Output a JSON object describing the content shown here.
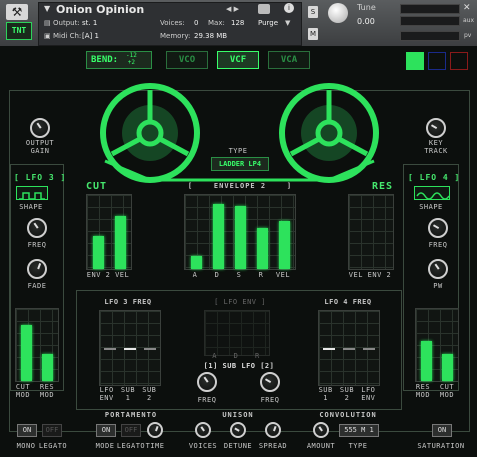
{
  "header": {
    "instrument_name": "Onion Opinion",
    "output_label": "Output:",
    "output_value": "st. 1",
    "midi_label": "Midi Ch:",
    "midi_value": "[A] 1",
    "voices_label": "Voices:",
    "voices_value": "0",
    "max_label": "Max:",
    "max_value": "128",
    "memory_label": "Memory:",
    "memory_value": "29.38 MB",
    "purge_label": "Purge",
    "s_label": "S",
    "m_label": "M",
    "tune_label": "Tune",
    "tune_value": "0.00",
    "aux_label": "aux",
    "pv_label": "pv"
  },
  "logo": "TNT",
  "top_bar": {
    "bend_label": "BEND:",
    "bend_top": "-12",
    "bend_bottom": "+2",
    "tabs": [
      "VCO",
      "VCF",
      "VCA"
    ],
    "active_tab": "VCF"
  },
  "color_squares": [
    "#2de25c",
    "#1a2a8a",
    "#8a1a1a"
  ],
  "top_section": {
    "output_gain_label": "OUTPUT\nGAIN",
    "key_track_label": "KEY\nTRACK",
    "type_label": "TYPE",
    "type_value": "LADDER LP4"
  },
  "lfo3": {
    "title": "[ LFO 3 ]",
    "shape_label": "SHAPE",
    "freq_label": "FREQ",
    "fade_label": "FADE",
    "cut_mod_label": "CUT\nMOD",
    "res_mod_label": "RES\nMOD",
    "mod_values": [
      0.78,
      0.38
    ]
  },
  "lfo4": {
    "title": "[ LFO 4 ]",
    "shape_label": "SHAPE",
    "freq_label": "FREQ",
    "pw_label": "PW",
    "res_mod_label": "RES\nMOD",
    "cut_mod_label": "CUT\nMOD",
    "mod_values": [
      0.55,
      0.38
    ]
  },
  "cut": {
    "title": "CUT",
    "labels": [
      "ENV 2",
      "VEL"
    ],
    "values": [
      0.45,
      0.72
    ]
  },
  "res": {
    "title": "RES",
    "labels": [
      "VEL",
      "ENV 2"
    ],
    "values": [
      0,
      0
    ]
  },
  "envelope2": {
    "title": "ENVELOPE 2",
    "labels": [
      "A",
      "D",
      "S",
      "R",
      "VEL"
    ],
    "values": [
      0.18,
      0.88,
      0.85,
      0.55,
      0.65
    ]
  },
  "lfo3_freq": {
    "title": "LFO 3 FREQ",
    "labels": [
      "LFO\nENV",
      "SUB\n1",
      "SUB\n2"
    ],
    "values": [
      0,
      0.45,
      0
    ]
  },
  "lfo_env": {
    "title": "[ LFO ENV ]",
    "labels": [
      "A",
      "D",
      "R"
    ]
  },
  "sub_lfo": {
    "title": "[1] SUB LFO [2]",
    "freq_label": "FREQ"
  },
  "lfo4_freq": {
    "title": "LFO 4 FREQ",
    "labels": [
      "SUB\n1",
      "SUB\n2",
      "LFO\nENV"
    ],
    "values": [
      0.45,
      0,
      0
    ]
  },
  "bottom": {
    "portamento_label": "PORTAMENTO",
    "unison_label": "UNISON",
    "convolution_label": "CONVOLUTION",
    "mono_on": "ON",
    "legato_off": "OFF",
    "mono_label": "MONO",
    "legato_label": "LEGATO",
    "mode_on": "ON",
    "mode_label": "MODE",
    "legato2_off": "OFF",
    "legato2_label": "LEGATO",
    "time_label": "TIME",
    "voices_label": "VOICES",
    "detune_label": "DETUNE",
    "spread_label": "SPREAD",
    "amount_label": "AMOUNT",
    "type_value": "555 M 1",
    "type_label": "TYPE",
    "saturation_on": "ON",
    "saturation_label": "SATURATION"
  }
}
